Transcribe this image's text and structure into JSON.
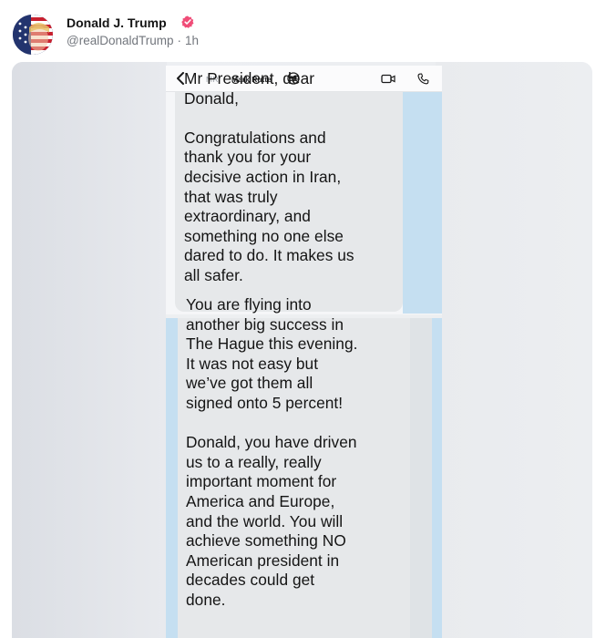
{
  "post": {
    "author_name": "Donald J. Trump",
    "handle": "@realDonaldTrump",
    "separator": "·",
    "time_ago": "1h"
  },
  "chat": {
    "contact_initials": "MR",
    "contact_name": "Mark Rutte",
    "messages": [
      "Mr President, dear\nDonald,\n\nCongratulations and\nthank you for your\ndecisive action in Iran,\nthat was truly\nextraordinary, and\nsomething no one else\ndared to do.  It makes us\nall safer.",
      "You are flying into\nanother big success in\nThe Hague this evening.\nIt was not easy but\nwe’ve got them all\nsigned onto 5 percent!\n\nDonald, you have driven\nus to a really, really\nimportant moment for\nAmerica and Europe,\nand the world.  You will\nachieve something NO\nAmerican president in\ndecades could get\ndone."
    ]
  },
  "colors": {
    "verified_badge": "#f04d78",
    "bubble_background": "#e6e8ea",
    "sender_strip_blue": "#c5dff1",
    "handle_gray": "#72767d"
  },
  "icons": {
    "back": "chevron-left-icon",
    "group": "group-icon",
    "video": "video-camera-icon",
    "call": "phone-icon",
    "verified": "verified-badge-icon"
  }
}
